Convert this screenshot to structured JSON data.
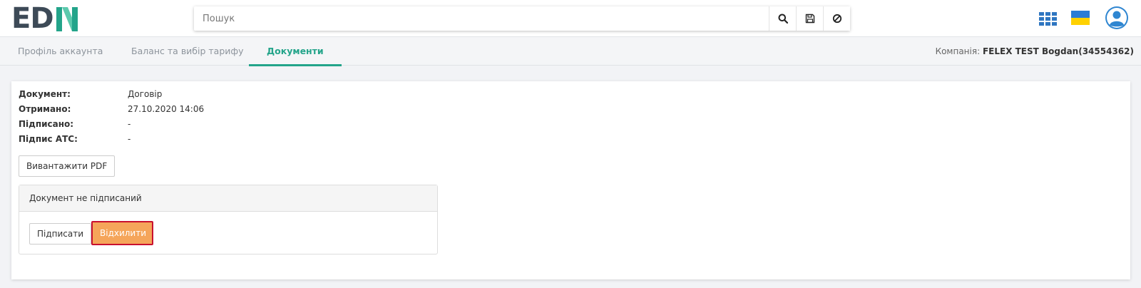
{
  "header": {
    "logo_text": "ED",
    "logo_accent_color": "#23a48a",
    "search_placeholder": "Пошук",
    "search_buttons": [
      "search-icon",
      "save-icon",
      "clear-icon"
    ],
    "icons": [
      "apps-grid-icon",
      "ukraine-flag-icon",
      "user-avatar-icon"
    ]
  },
  "tabs": [
    {
      "label": "Профіль аккаунта",
      "active": false
    },
    {
      "label": "Баланс та вибір тарифу",
      "active": false
    },
    {
      "label": "Документи",
      "active": true
    }
  ],
  "company": {
    "label": "Компанія:",
    "value": "FELEX TEST Bogdan(34554362)"
  },
  "document": {
    "fields": [
      {
        "label": "Документ:",
        "value": "Договір"
      },
      {
        "label": "Отримано:",
        "value": "27.10.2020 14:06"
      },
      {
        "label": "Підписано:",
        "value": "-"
      },
      {
        "label": "Підпис АТС:",
        "value": "-"
      }
    ],
    "download_pdf_label": "Вивантажити PDF"
  },
  "signature": {
    "status_text": "Документ не підписаний",
    "sign_label": "Підписати",
    "reject_label": "Відхилити"
  },
  "colors": {
    "accent": "#23a48a",
    "reject_bg": "#f5a55a",
    "reject_highlight": "#c8102e"
  }
}
